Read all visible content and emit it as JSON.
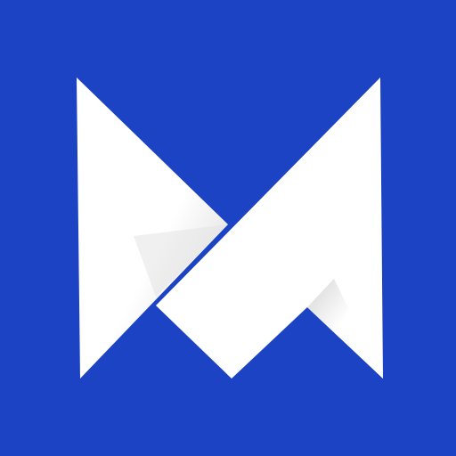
{
  "app_icon": {
    "logo_name": "",
    "background_color": "#1b43c4",
    "mark_color": "#ffffff",
    "shade_color": "#cfcfcf"
  }
}
